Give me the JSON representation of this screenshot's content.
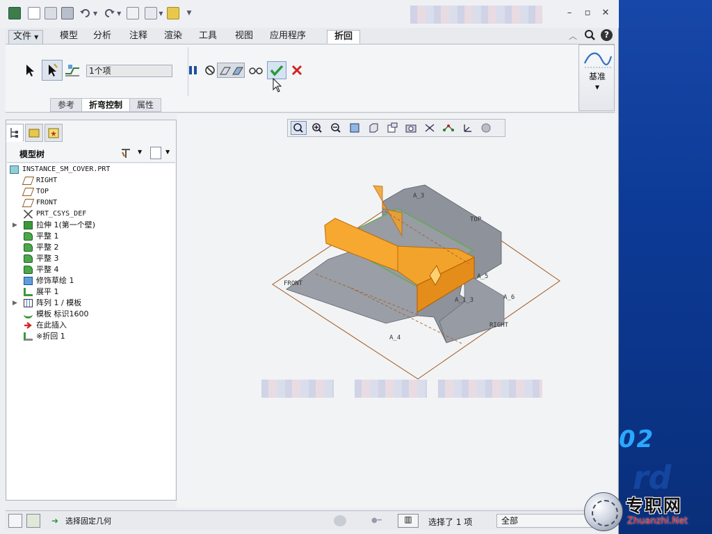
{
  "menus": {
    "file": "文件",
    "tabs": [
      "模型",
      "分析",
      "注释",
      "渲染",
      "工具",
      "视图",
      "应用程序"
    ],
    "active_tab": "折回"
  },
  "ribbon": {
    "selection_value": "1个项",
    "subtabs": [
      "参考",
      "折弯控制",
      "属性"
    ],
    "active_subtab": "折弯控制",
    "datum_label": "基准",
    "accent_ok": "#2a9a3a",
    "accent_cancel": "#d42020"
  },
  "model_tree": {
    "title": "模型树",
    "root": "INSTANCE_SM_COVER.PRT",
    "items": [
      {
        "label": "RIGHT",
        "icon": "datum-plane-icon",
        "expandable": false
      },
      {
        "label": "TOP",
        "icon": "datum-plane-icon",
        "expandable": false
      },
      {
        "label": "FRONT",
        "icon": "datum-plane-icon",
        "expandable": false
      },
      {
        "label": "PRT_CSYS_DEF",
        "icon": "csys-icon",
        "expandable": false
      },
      {
        "label": "拉伸 1(第一个壁)",
        "icon": "extrude-wall-icon",
        "expandable": true
      },
      {
        "label": "平整 1",
        "icon": "flat-wall-icon",
        "expandable": false
      },
      {
        "label": "平整 2",
        "icon": "flat-wall-icon",
        "expandable": false
      },
      {
        "label": "平整 3",
        "icon": "flat-wall-icon",
        "expandable": false
      },
      {
        "label": "平整 4",
        "icon": "flat-wall-icon",
        "expandable": false
      },
      {
        "label": "修饰草绘 1",
        "icon": "cosmetic-sketch-icon",
        "expandable": false
      },
      {
        "label": "展平 1",
        "icon": "unbend-icon",
        "expandable": false
      },
      {
        "label": "阵列 1 / 模板",
        "icon": "pattern-icon",
        "expandable": true
      },
      {
        "label": "模板 标识1600",
        "icon": "form-icon",
        "expandable": false
      },
      {
        "label": "在此插入",
        "icon": "insert-here-icon",
        "expandable": false
      },
      {
        "label": "※折回 1",
        "icon": "bend-back-icon",
        "expandable": false
      }
    ]
  },
  "viewport": {
    "datum_labels": [
      "TOP",
      "FRONT",
      "RIGHT",
      "A_3",
      "A_5",
      "A_6",
      "A_1_3",
      "A_4"
    ]
  },
  "status": {
    "message": "选择固定几何",
    "selected": "选择了 1 项",
    "filter": "全部"
  },
  "watermark": {
    "number": "02",
    "site_cn": "专职网",
    "site_en": "Zhuanzhi.Net"
  }
}
